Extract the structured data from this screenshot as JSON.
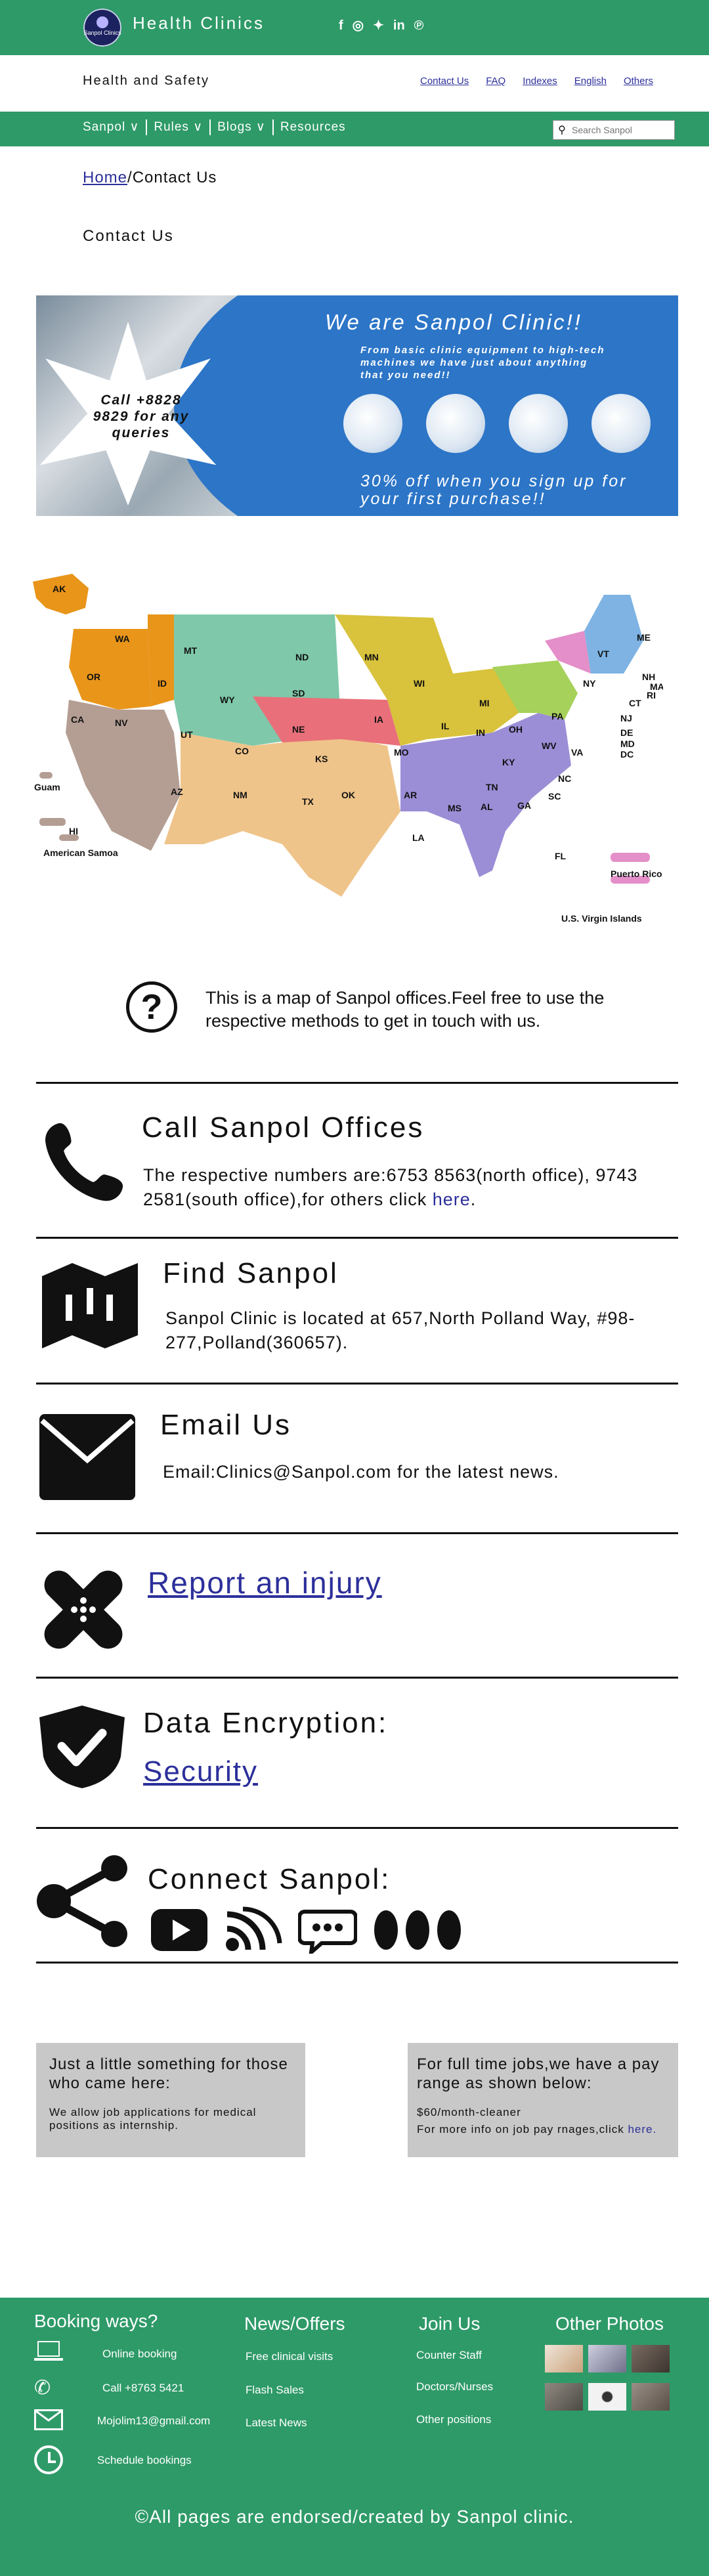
{
  "header": {
    "logo_text": "Sanpol Clinics",
    "site_title": "Health Clinics",
    "social": [
      {
        "icon": "facebook-icon",
        "glyph": "f"
      },
      {
        "icon": "instagram-icon",
        "glyph": "◎"
      },
      {
        "icon": "twitter-icon",
        "glyph": "✦"
      },
      {
        "icon": "linkedin-icon",
        "glyph": "in"
      },
      {
        "icon": "pinterest-icon",
        "glyph": "℗"
      }
    ]
  },
  "subheader": {
    "title": "Health and Safety",
    "links": [
      "Contact Us",
      "FAQ",
      "Indexes",
      "English",
      "Others"
    ]
  },
  "nav": {
    "items": [
      "Sanpol ∨",
      "Rules ∨",
      "Blogs ∨",
      "Resources"
    ],
    "search_placeholder": "Search Sanpol"
  },
  "breadcrumb": {
    "home": "Home",
    "separator": "/",
    "current": "Contact Us"
  },
  "page_heading": "Contact Us",
  "banner": {
    "star_text": "Call +8828 9829 for any queries",
    "title": "We are Sanpol Clinic!!",
    "subtitle": "From basic clinic equipment to high-tech machines we have just about anything that you need!!",
    "offer": "30% off when you sign up for your first purchase!!"
  },
  "map": {
    "labels": [
      "AK",
      "WA",
      "OR",
      "CA",
      "NV",
      "ID",
      "MT",
      "WY",
      "UT",
      "AZ",
      "CO",
      "NM",
      "ND",
      "SD",
      "NE",
      "KS",
      "OK",
      "TX",
      "MN",
      "IA",
      "MO",
      "AR",
      "LA",
      "WI",
      "IL",
      "MI",
      "IN",
      "OH",
      "KY",
      "TN",
      "MS",
      "AL",
      "GA",
      "FL",
      "SC",
      "NC",
      "VA",
      "WV",
      "PA",
      "NY",
      "VT",
      "ME",
      "NH",
      "MA",
      "RI",
      "CT",
      "NJ",
      "DE",
      "MD",
      "DC",
      "Guam",
      "HI",
      "American Samoa",
      "Puerto Rico",
      "U.S. Virgin Islands"
    ]
  },
  "info": {
    "qmark": "?",
    "caption": "This is a map of Sanpol offices.Feel free to use the respective methods to get in touch with us."
  },
  "call": {
    "title": "Call Sanpol Offices",
    "text": "The respective numbers are:6753 8563(north office), 9743 2581(south office),for others click ",
    "link": "here",
    "end": "."
  },
  "find": {
    "title": "Find Sanpol",
    "text": "Sanpol Clinic is located at  657,North Polland Way, #98-277,Polland(360657)."
  },
  "email": {
    "title": "Email Us",
    "text": "Email:Clinics@Sanpol.com for the latest news."
  },
  "injury": {
    "link": "Report an injury"
  },
  "encryption": {
    "title": "Data Encryption:",
    "link": "Security"
  },
  "connect": {
    "title": "Connect Sanpol:"
  },
  "box_left": {
    "title": "Just a little something for those who came here:",
    "text": "We allow job applications for medical positions as internship."
  },
  "box_right": {
    "title": "For full time jobs,we have a pay range as shown below:",
    "line1": "$60/month-cleaner",
    "line2": "For more info on job pay rnages,click ",
    "link": "here."
  },
  "footer": {
    "booking_title": "Booking ways?",
    "booking": [
      "Online booking",
      "Call +8763 5421",
      "Mojolim13@gmail.com",
      "Schedule bookings"
    ],
    "news_title": "News/Offers",
    "news": [
      "Free clinical visits",
      "Flash Sales",
      "Latest News"
    ],
    "join_title": "Join Us",
    "join": [
      "Counter Staff",
      "Doctors/Nurses",
      "Other positions"
    ],
    "photos_title": "Other Photos",
    "copyright": "©All pages are endorsed/created by Sanpol clinic."
  }
}
